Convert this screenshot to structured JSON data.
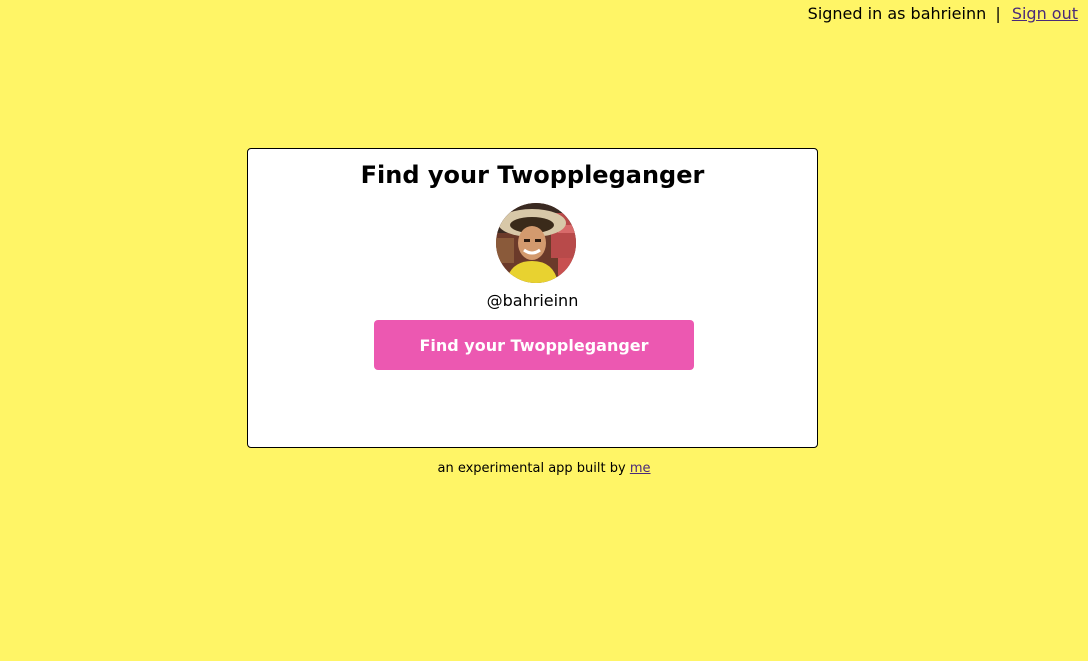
{
  "header": {
    "signed_in_text": "Signed in as bahrieinn",
    "separator": "|",
    "sign_out_label": "Sign out"
  },
  "card": {
    "title": "Find your Twoppleganger",
    "avatar_icon": "user-avatar-photo",
    "username": "@bahrieinn",
    "button_label": "Find your Twoppleganger"
  },
  "footer": {
    "text": "an experimental app built by",
    "link_label": "me"
  },
  "colors": {
    "background": "#fff566",
    "button": "#ec58b1",
    "link": "#4a2a7a"
  }
}
